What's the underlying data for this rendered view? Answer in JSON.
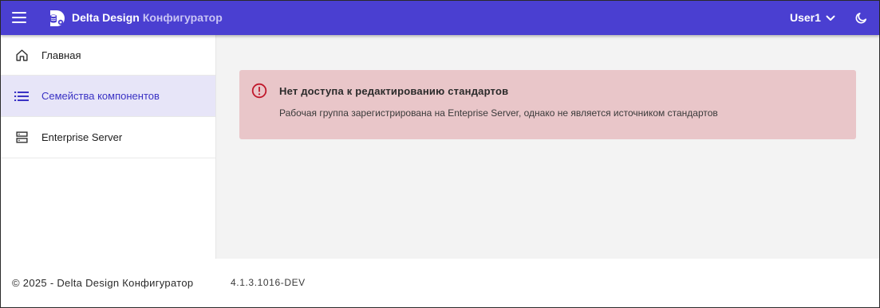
{
  "header": {
    "brand_name": "Delta Design",
    "brand_sub": "Конфигуратор",
    "user_label": "User1",
    "colors": {
      "bar": "#4a3fd1",
      "sub": "#c9c4f5"
    }
  },
  "sidebar": {
    "items": [
      {
        "label": "Главная",
        "icon": "home-icon",
        "active": false
      },
      {
        "label": "Семейства компонентов",
        "icon": "list-icon",
        "active": true
      },
      {
        "label": "Enterprise Server",
        "icon": "server-icon",
        "active": false
      }
    ]
  },
  "alert": {
    "title": "Нет доступа к редактированию стандартов",
    "message": "Рабочая группа зарегистрирована на Enteprise Server, однако не является источником стандартов",
    "icon": "error-circle-icon",
    "color": "#e9c6c9"
  },
  "footer": {
    "copyright": "© 2025 - Delta Design Конфигуратор",
    "version": "4.1.3.1016-DEV"
  }
}
